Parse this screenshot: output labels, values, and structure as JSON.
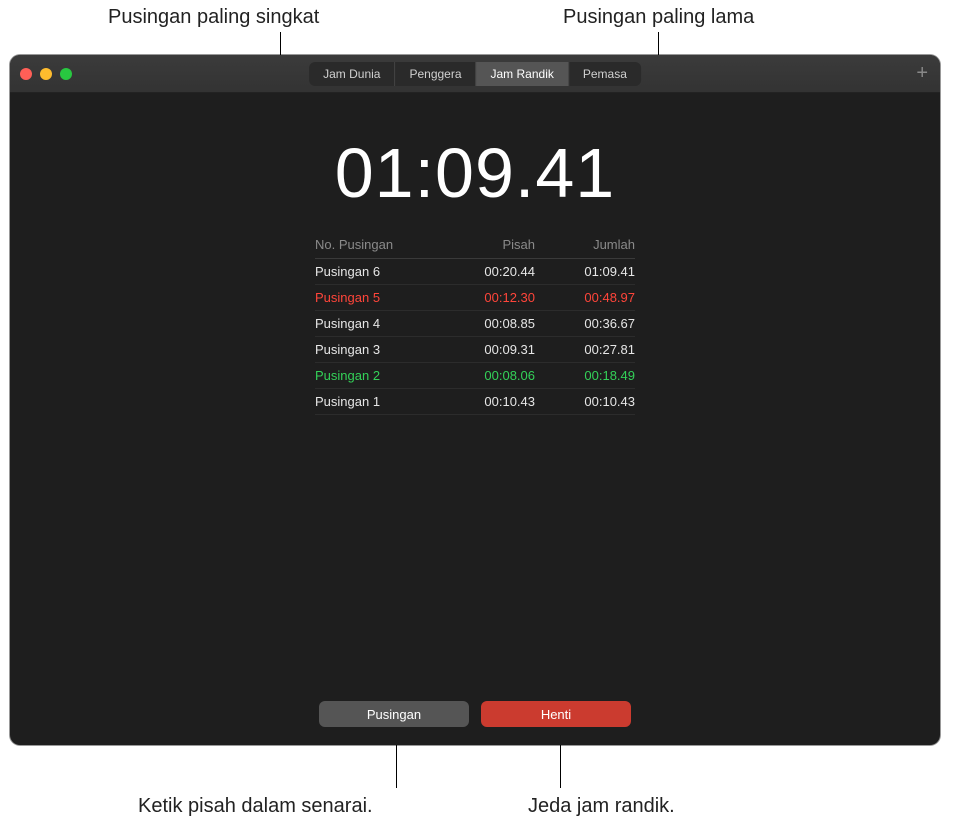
{
  "callouts": {
    "top_left": "Pusingan paling singkat",
    "top_right": "Pusingan paling lama",
    "bottom_left": "Ketik pisah dalam senarai.",
    "bottom_right": "Jeda jam randik."
  },
  "titlebar": {
    "tabs": {
      "world": "Jam Dunia",
      "alarm": "Penggera",
      "stopwatch": "Jam Randik",
      "timer": "Pemasa"
    },
    "plus": "+"
  },
  "stopwatch": {
    "main_time": "01:09.41",
    "headers": {
      "lap_no": "No. Pusingan",
      "split": "Pisah",
      "total": "Jumlah"
    },
    "laps": [
      {
        "name": "Pusingan 6",
        "split": "00:20.44",
        "total": "01:09.41",
        "style": ""
      },
      {
        "name": "Pusingan 5",
        "split": "00:12.30",
        "total": "00:48.97",
        "style": "slowest"
      },
      {
        "name": "Pusingan 4",
        "split": "00:08.85",
        "total": "00:36.67",
        "style": ""
      },
      {
        "name": "Pusingan 3",
        "split": "00:09.31",
        "total": "00:27.81",
        "style": ""
      },
      {
        "name": "Pusingan 2",
        "split": "00:08.06",
        "total": "00:18.49",
        "style": "fastest"
      },
      {
        "name": "Pusingan 1",
        "split": "00:10.43",
        "total": "00:10.43",
        "style": ""
      }
    ],
    "buttons": {
      "lap": "Pusingan",
      "stop": "Henti"
    }
  }
}
